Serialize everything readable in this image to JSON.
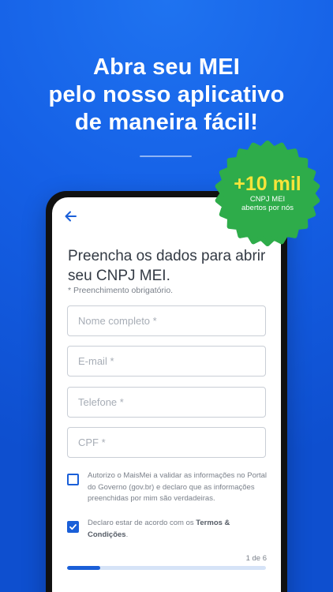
{
  "hero": {
    "line1": "Abra seu MEI",
    "line2": "pelo nosso aplicativo",
    "line3": "de maneira fácil!"
  },
  "badge": {
    "headline": "+10 mil",
    "line1": "CNPJ MEI",
    "line2": "abertos por nós",
    "color": "#2eac4a",
    "headline_color": "#f7e43a"
  },
  "form": {
    "title": "Preencha os dados para abrir seu CNPJ MEI.",
    "required_note": "* Preenchimento obrigatório.",
    "fields": {
      "name_placeholder": "Nome completo *",
      "name_value": "",
      "email_placeholder": "E-mail *",
      "email_value": "",
      "phone_placeholder": "Telefone *",
      "phone_value": "",
      "cpf_placeholder": "CPF *",
      "cpf_value": ""
    },
    "consent": {
      "checked": false,
      "text": "Autorizo o MaisMei a validar as informações no Portal do Governo (gov.br) e declaro que as informações preenchidas por mim são verdadeiras."
    },
    "terms": {
      "checked": true,
      "prefix": "Declaro estar de acordo com os ",
      "link": "Termos & Condições",
      "suffix": "."
    },
    "step": {
      "label": "1 de 6",
      "current": 1,
      "total": 6
    }
  },
  "colors": {
    "background": "#1560e6",
    "primary": "#1a5fd8",
    "progress_track": "#d6e3f7"
  },
  "icons": {
    "back": "arrow-left",
    "check": "checkmark"
  }
}
